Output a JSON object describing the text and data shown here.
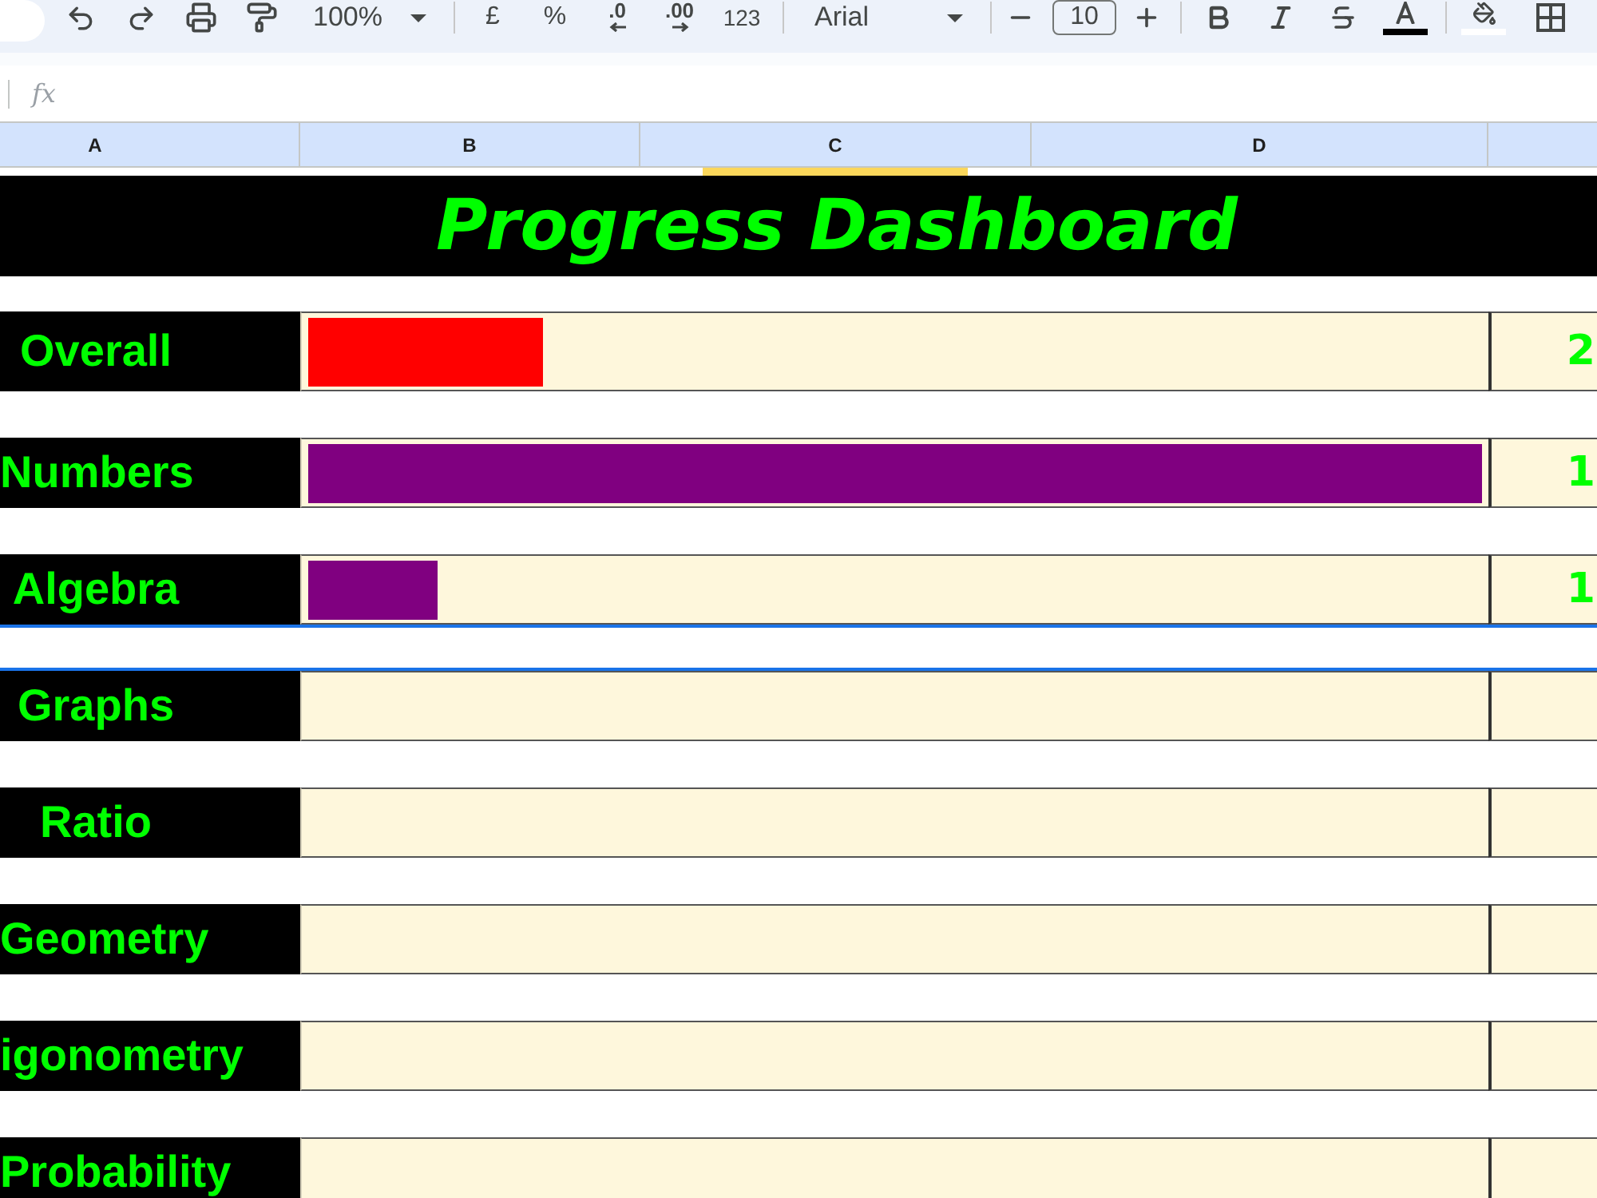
{
  "toolbar": {
    "zoom": "100%",
    "currency": "£",
    "percent": "%",
    "decrease_decimals": ".0",
    "increase_decimals": ".00",
    "number_format": "123",
    "font": "Arial",
    "font_size": "10"
  },
  "formula_bar": {
    "label": "fx"
  },
  "column_headers": [
    "A",
    "B",
    "C",
    "D"
  ],
  "dashboard": {
    "title": "Progress Dashboard",
    "rows": [
      {
        "kind": "gap",
        "selected": false
      },
      {
        "kind": "bar",
        "label": "Overall",
        "level": 0.2,
        "color": "#ff0000",
        "value": "2"
      },
      {
        "kind": "gap",
        "selected": false
      },
      {
        "kind": "bar",
        "label": "Numbers",
        "level": 1,
        "color": "#800080",
        "value": "1"
      },
      {
        "kind": "gap",
        "selected": false
      },
      {
        "kind": "bar",
        "label": "Algebra",
        "level": 0.11,
        "color": "#800080",
        "value": "1"
      },
      {
        "kind": "gap",
        "selected": true
      },
      {
        "kind": "bar",
        "label": "Graphs"
      },
      {
        "kind": "gap",
        "selected": false
      },
      {
        "kind": "bar",
        "label": "Ratio"
      },
      {
        "kind": "gap",
        "selected": false
      },
      {
        "kind": "bar",
        "label": "Geometry"
      },
      {
        "kind": "gap",
        "selected": false
      },
      {
        "kind": "bar",
        "label": "igonometry"
      },
      {
        "kind": "gap",
        "selected": false
      },
      {
        "kind": "bar",
        "label": "Probability"
      }
    ]
  }
}
